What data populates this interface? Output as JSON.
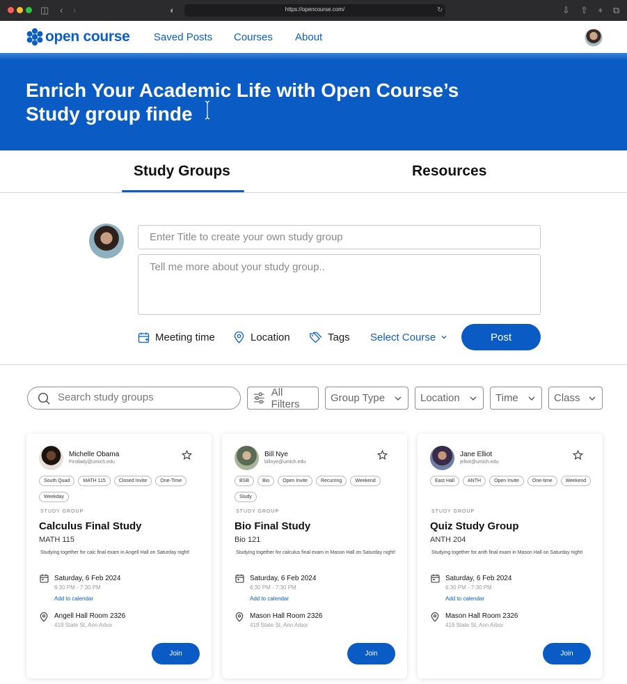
{
  "browser": {
    "url": "https://opencourse.com/"
  },
  "nav": {
    "logo_text": "open course",
    "links": [
      "Saved Posts",
      "Courses",
      "About"
    ]
  },
  "hero": {
    "title": "Enrich Your Academic Life with Open Course’s Study group finde"
  },
  "tabs": [
    "Study Groups",
    "Resources"
  ],
  "composer": {
    "title_placeholder": "Enter Title to create your own study group",
    "desc_placeholder": "Tell me more about your study group..",
    "meeting_time": "Meeting time",
    "location": "Location",
    "tags": "Tags",
    "select_course": "Select Course",
    "post": "Post"
  },
  "filters": {
    "search_placeholder": "Search study groups",
    "all_filters": "All Filters",
    "group_type": "Group Type",
    "location": "Location",
    "time": "Time",
    "class": "Class"
  },
  "cards": [
    {
      "name": "Michelle Obama",
      "email": "Firstlady@umich.edu",
      "tags": [
        "South Quad",
        "MATH 115",
        "Closed Invite",
        "One-Time",
        "Weekday"
      ],
      "label": "STUDY GROUP",
      "title": "Calculus Final Study",
      "course": "MATH 115",
      "desc": "Studying together for calc final exam in Angell Hall on Saturday night!",
      "date": "Saturday, 6 Feb 2024",
      "time": "6:30 PM - 7:30 PM",
      "add_cal": "Add to calendar",
      "location": "Angell Hall Room 2326",
      "address": "419 State St, Ann Arbor",
      "join": "Join"
    },
    {
      "name": "Bill Nye",
      "email": "billnye@umich.edu",
      "tags": [
        "BSB",
        "Bio",
        "Open Invite",
        "Recurring",
        "Weekend",
        "Study"
      ],
      "label": "STUDY GROUP",
      "title": "Bio Final Study",
      "course": "Bio 121",
      "desc": "Studying together for calculus final exam in Mason Hall on Saturday night!",
      "date": "Saturday, 6 Feb 2024",
      "time": "6:30 PM - 7:30 PM",
      "add_cal": "Add to calendar",
      "location": "Mason Hall Room 2326",
      "address": "419 State St, Ann Arbor",
      "join": "Join"
    },
    {
      "name": "Jane Elliot",
      "email": "jelliot@umich.edu",
      "tags": [
        "East Hall",
        "ANTH",
        "Open Invite",
        "One-time",
        "Weekend"
      ],
      "label": "STUDY GROUP",
      "title": "Quiz Study Group",
      "course": "ANTH 204",
      "desc": "Studying together for anth final exam in Mason Hall on Saturday night!",
      "date": "Saturday, 6 Feb 2024",
      "time": "6:30 PM - 7:30 PM",
      "add_cal": "Add to calendar",
      "location": "Mason Hall Room 2326",
      "address": "419 State St, Ann Arbor",
      "join": "Join"
    }
  ],
  "colors": {
    "brand": "#0a5cc4",
    "hero": "#0a5cc4"
  }
}
